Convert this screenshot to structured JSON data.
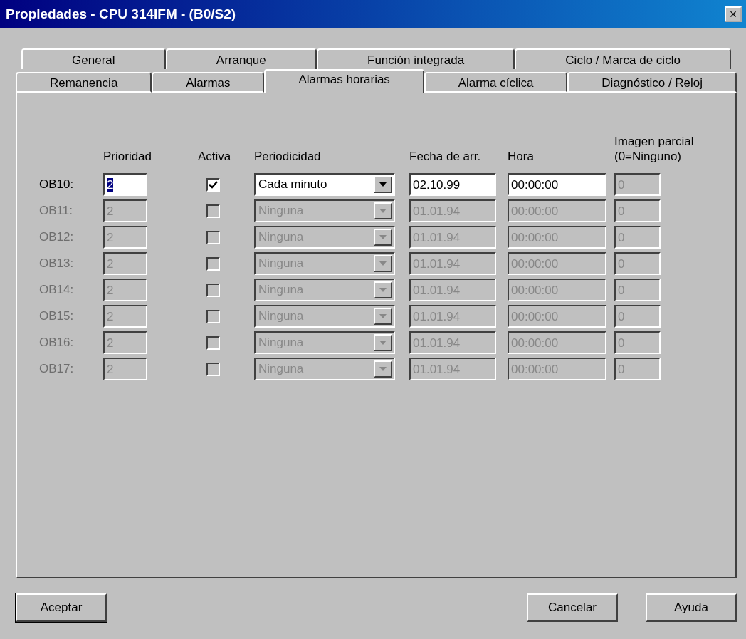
{
  "window": {
    "title": "Propiedades - CPU 314IFM - (B0/S2)",
    "close": "×"
  },
  "tab_rows": [
    [
      {
        "label": "General",
        "selected": false
      },
      {
        "label": "Arranque",
        "selected": false
      },
      {
        "label": "Función integrada",
        "selected": false
      },
      {
        "label": "Ciclo / Marca de ciclo",
        "selected": false
      }
    ],
    [
      {
        "label": "Remanencia",
        "selected": false
      },
      {
        "label": "Alarmas",
        "selected": false
      },
      {
        "label": "Alarmas horarias",
        "selected": true
      },
      {
        "label": "Alarma cíclica",
        "selected": false
      },
      {
        "label": "Diagnóstico / Reloj",
        "selected": false
      }
    ]
  ],
  "columns": [
    "Prioridad",
    "Activa",
    "Periodicidad",
    "Fecha de arr.",
    "Hora",
    "Imagen parcial\n(0=Ninguno)"
  ],
  "rows": [
    {
      "label": "OB10:",
      "priority": "2",
      "priority_selected": true,
      "active": true,
      "periodicity": "Cada minuto",
      "date": "02.10.99",
      "time": "00:00:00",
      "partial_image": "0",
      "enabled": true
    },
    {
      "label": "OB11:",
      "priority": "2",
      "priority_selected": false,
      "active": false,
      "periodicity": "Ninguna",
      "date": "01.01.94",
      "time": "00:00:00",
      "partial_image": "0",
      "enabled": false
    },
    {
      "label": "OB12:",
      "priority": "2",
      "priority_selected": false,
      "active": false,
      "periodicity": "Ninguna",
      "date": "01.01.94",
      "time": "00:00:00",
      "partial_image": "0",
      "enabled": false
    },
    {
      "label": "OB13:",
      "priority": "2",
      "priority_selected": false,
      "active": false,
      "periodicity": "Ninguna",
      "date": "01.01.94",
      "time": "00:00:00",
      "partial_image": "0",
      "enabled": false
    },
    {
      "label": "OB14:",
      "priority": "2",
      "priority_selected": false,
      "active": false,
      "periodicity": "Ninguna",
      "date": "01.01.94",
      "time": "00:00:00",
      "partial_image": "0",
      "enabled": false
    },
    {
      "label": "OB15:",
      "priority": "2",
      "priority_selected": false,
      "active": false,
      "periodicity": "Ninguna",
      "date": "01.01.94",
      "time": "00:00:00",
      "partial_image": "0",
      "enabled": false
    },
    {
      "label": "OB16:",
      "priority": "2",
      "priority_selected": false,
      "active": false,
      "periodicity": "Ninguna",
      "date": "01.01.94",
      "time": "00:00:00",
      "partial_image": "0",
      "enabled": false
    },
    {
      "label": "OB17:",
      "priority": "2",
      "priority_selected": false,
      "active": false,
      "periodicity": "Ninguna",
      "date": "01.01.94",
      "time": "00:00:00",
      "partial_image": "0",
      "enabled": false
    }
  ],
  "buttons": {
    "left": [
      "Aceptar"
    ],
    "right": [
      "Cancelar",
      "Ayuda"
    ]
  }
}
